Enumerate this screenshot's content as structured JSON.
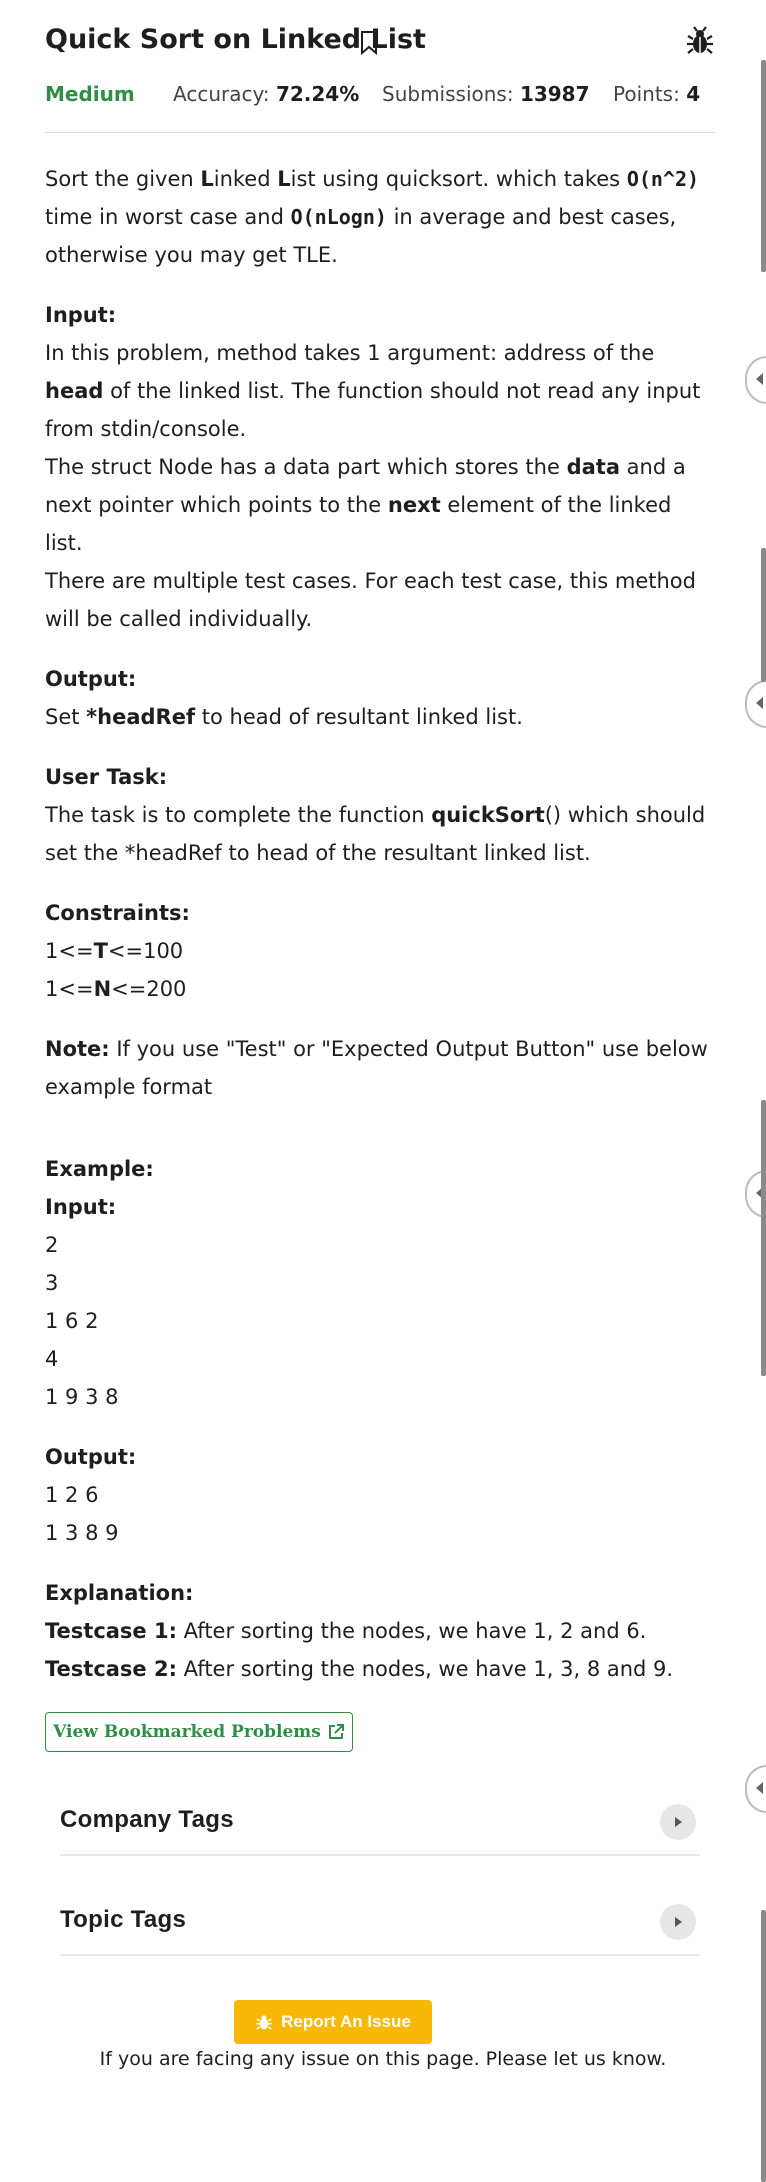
{
  "problem": {
    "title": "Quick Sort on Linked List",
    "difficulty": "Medium",
    "accuracy_label": "Accuracy:",
    "accuracy": "72.24%",
    "submissions_label": "Submissions:",
    "submissions": "13987",
    "points_label": "Points:",
    "points": "4"
  },
  "statement": {
    "p1_a": "Sort the given ",
    "p1_L1": "L",
    "p1_b": "inked ",
    "p1_L2": "L",
    "p1_c": "ist using quicksort. which takes ",
    "p1_worst": "O(n^2)",
    "p1_d": " time in worst case and ",
    "p1_avg": "O(nLogn)",
    "p1_e": " in average and best cases, otherwise you may get TLE.",
    "input_heading": "Input:",
    "input_a": "In this problem, method takes 1 argument: address of the ",
    "input_head": "head",
    "input_b": " of the linked list. The function should not read any input from stdin/console.",
    "input_c": "The struct Node has a data part which stores the ",
    "input_data": "data",
    "input_d": " and a next pointer which points to the ",
    "input_next": "next",
    "input_e": " element of the linked list.",
    "input_f": "There are multiple test cases. For each test case, this method will be called individually.",
    "output_heading": "Output:",
    "output_a": "Set ",
    "output_ref": "*headRef",
    "output_b": " to head of resultant linked list.",
    "task_heading": "User Task:",
    "task_a": "The task is to complete the function ",
    "task_fn": "quickSort",
    "task_b": "() which should set the *headRef to head of the resultant linked list.",
    "constraints_heading": "Constraints:",
    "c1_a": "1<=",
    "c1_var": "T",
    "c1_b": "<=100",
    "c2_a": "1<=",
    "c2_var": "N",
    "c2_b": "<=200",
    "note_label": "Note:",
    "note_text": " If you use \"Test\" or \"Expected Output Button\" use below example format",
    "example_heading": "Example:",
    "ex_input_heading": "Input:",
    "ex_input_lines": [
      "2",
      "3",
      "1 6 2",
      "4",
      "1 9 3 8"
    ],
    "ex_output_heading": "Output:",
    "ex_output_lines": [
      "1 2 6",
      "1 3 8 9"
    ],
    "explanation_heading": "Explanation:",
    "tc1_label": "Testcase 1:",
    "tc1_text": " After sorting the nodes, we have 1, 2 and 6.",
    "tc2_label": "Testcase 2:",
    "tc2_text": " After sorting the nodes, we have 1, 3, 8 and 9."
  },
  "actions": {
    "bookmarked_label": "View Bookmarked Problems",
    "company_tags": "Company Tags",
    "topic_tags": "Topic Tags",
    "report_label": "Report An Issue",
    "report_note": "If you are facing any issue on this page. Please let us know."
  },
  "colors": {
    "accent_green": "#2f8d46",
    "report_yellow": "#f9b706"
  },
  "icons": [
    "bookmark-icon",
    "bug-icon",
    "external-link-icon",
    "caret-right-icon",
    "collapse-icon"
  ]
}
